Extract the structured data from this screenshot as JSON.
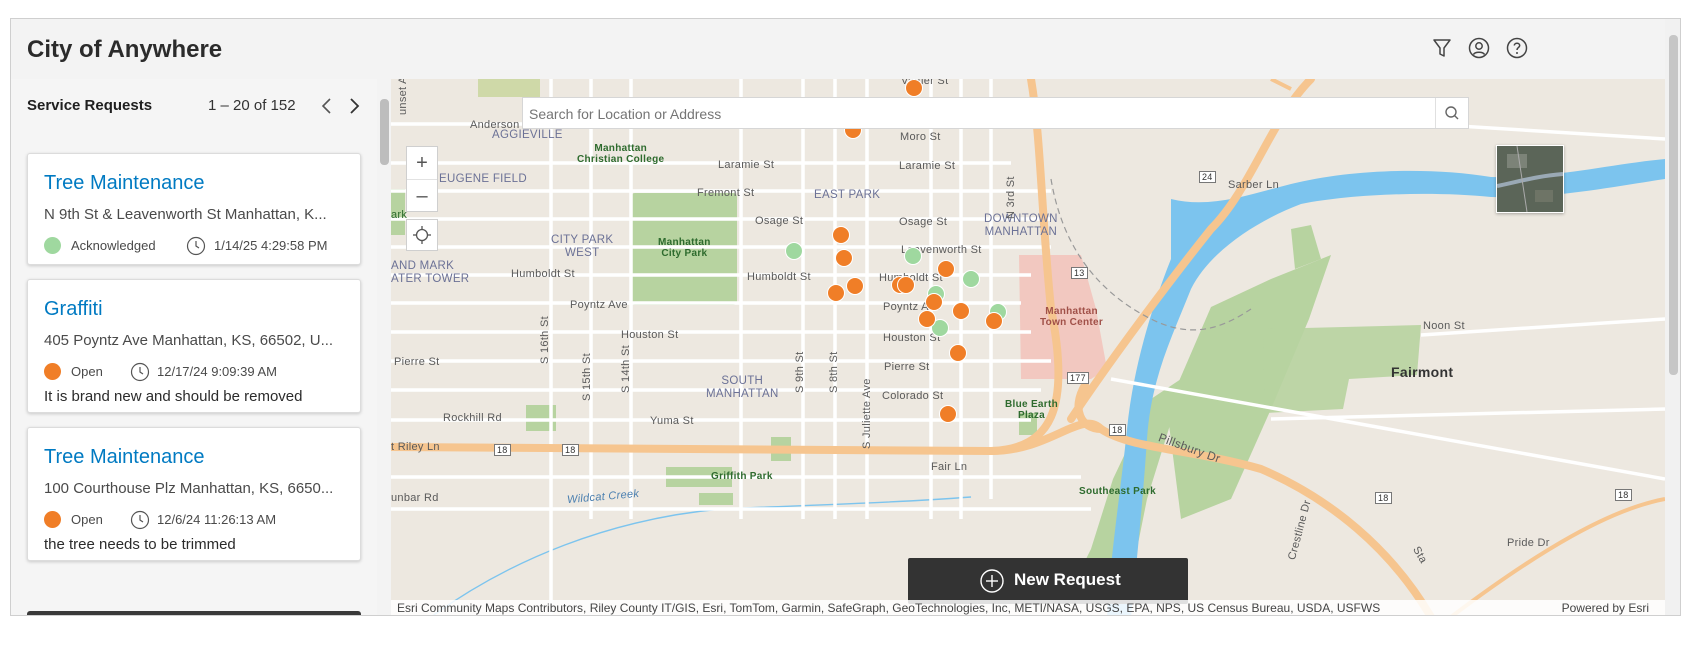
{
  "app": {
    "title": "City of Anywhere"
  },
  "header_icons": [
    "filter-icon",
    "user-icon",
    "help-icon"
  ],
  "list": {
    "title": "Service Requests",
    "count": "1 – 20 of 152",
    "cards": [
      {
        "title": "Tree Maintenance",
        "address": "N 9th St & Leavenworth St Manhattan, K...",
        "status": "Acknowledged",
        "status_color": "#9fd89f",
        "date": "1/14/25 4:29:58 PM",
        "description": ""
      },
      {
        "title": "Graffiti",
        "address": "405 Poyntz Ave Manhattan, KS, 66502, U...",
        "status": "Open",
        "status_color": "#f07e27",
        "date": "12/17/24 9:09:39 AM",
        "description": "It is brand new and should be removed"
      },
      {
        "title": "Tree Maintenance",
        "address": "100 Courthouse Plz Manhattan, KS, 6650...",
        "status": "Open",
        "status_color": "#f07e27",
        "date": "12/6/24 11:26:13 AM",
        "description": "the tree needs to be trimmed"
      }
    ]
  },
  "map": {
    "search_placeholder": "Search for Location or Address",
    "new_request_label": "New Request",
    "attribution": "Esri Community Maps Contributors, Riley County IT/GIS, Esri, TomTom, Garmin, SafeGraph, GeoTechnologies, Inc, METI/NASA, USGS, EPA, NPS, US Census Bureau, USDA, USFWS",
    "powered_by": "Powered by Esri",
    "zoom_in": "+",
    "zoom_out": "–",
    "labels": {
      "aggieville": "AGGIEVILLE",
      "mcc": "Manhattan\nChristian College",
      "eugene": "EUGENE FIELD",
      "eastpark": "EAST PARK",
      "cpw": "CITY PARK\nWEST",
      "mcp": "Manhattan\nCity Park",
      "downtown": "DOWNTOWN\nMANHATTAN",
      "andmark": "AND MARK\nATER TOWER",
      "southman": "SOUTH\nMANHATTAN",
      "fairmont": "Fairmont",
      "blueearth": "Blue Earth\nPlaza",
      "griffith": "Griffith Park",
      "southeast": "Southeast Park",
      "mtc": "Manhattan\nTown Center",
      "wildcat": "Wildcat Creek",
      "laramie1": "Laramie St",
      "laramie2": "Laramie St",
      "moro": "Moro St",
      "fremont": "Fremont St",
      "osage1": "Osage St",
      "osage2": "Osage St",
      "leav": "Leavenworth St",
      "humboldt1": "Humboldt St",
      "humboldt2": "Humboldt St",
      "humboldt3": "Humboldt St",
      "poyntz1": "Poyntz Ave",
      "poyntz2": "Poyntz Ave",
      "houston1": "Houston St",
      "houston2": "Houston St",
      "pierre1": "Pierre St",
      "pierre2": "Pierre St",
      "colorado": "Colorado St",
      "yuma": "Yuma St",
      "rockhill": "Rockhill Rd",
      "fairln": "Fair Ln",
      "rileyln": "t Riley Ln",
      "unbar": "unbar Rd",
      "anderson": "Anderson Ave",
      "sarber": "Sarber Ln",
      "noon": "Noon St",
      "pillsbury": "Pillsbury Dr",
      "pride": "Pride Dr",
      "s16": "S 16th St",
      "s15": "S 15th St",
      "s14": "S 14th St",
      "s9": "S 9th St",
      "s8": "S 8th St",
      "sjuliette": "S Juliette Ave",
      "n3rd": "N 3rd St",
      "vattier": "Vattier St",
      "ark": "ark",
      "sunset": "unset Av",
      "rt18a": "18",
      "rt18b": "18",
      "rt18c": "18",
      "rt18d": "18",
      "rt18e": "18",
      "rt13": "13",
      "rt24": "24",
      "rt177": "177",
      "crestline": "Crestline Dr",
      "sta": "Sta"
    }
  },
  "colors": {
    "accent": "#007ac2",
    "open": "#f07e27",
    "acknowledged": "#9fd89f",
    "highway": "#f6c58f",
    "river": "#7cc4ee",
    "park": "#b7d3a0"
  },
  "markers": [
    {
      "status": "Open"
    },
    {
      "status": "Open"
    },
    {
      "status": "Open"
    },
    {
      "status": "Open"
    },
    {
      "status": "Acknowledged"
    },
    {
      "status": "Acknowledged"
    },
    {
      "status": "Open"
    },
    {
      "status": "Open"
    },
    {
      "status": "Acknowledged"
    },
    {
      "status": "Open"
    },
    {
      "status": "Open"
    },
    {
      "status": "Acknowledged"
    },
    {
      "status": "Open"
    },
    {
      "status": "Open"
    },
    {
      "status": "Acknowledged"
    },
    {
      "status": "Acknowledged"
    },
    {
      "status": "Open"
    },
    {
      "status": "Open"
    },
    {
      "status": "Open"
    },
    {
      "status": "Open"
    },
    {
      "status": "Open"
    }
  ]
}
